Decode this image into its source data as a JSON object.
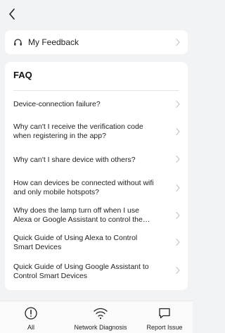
{
  "header": {
    "back_icon": "chevron-left-icon"
  },
  "feedback": {
    "label": "My Feedback",
    "icon": "headset-icon"
  },
  "faq": {
    "title": "FAQ",
    "items": [
      {
        "lines": [
          "Device-connection failure?"
        ]
      },
      {
        "lines": [
          "Why can't I receive the verification code",
          "when registering in the app?"
        ]
      },
      {
        "lines": [
          "Why can't I share device with others?"
        ]
      },
      {
        "lines": [
          "How can devices be connected without wifi",
          "and only mobile hotspots?"
        ]
      },
      {
        "lines": [
          "Why does the lamp turn off when I use",
          "Alexa or Google Assistant to control the…"
        ]
      },
      {
        "lines": [
          "Quick Guide of Using Alexa to Control",
          "Smart Devices"
        ]
      },
      {
        "lines": [
          "Quick Guide of Using Google Assistant to",
          "Control Smart Devices"
        ]
      }
    ]
  },
  "tabs": [
    {
      "label": "All",
      "icon": "alert-circle-icon"
    },
    {
      "label": "Network Diagnosis",
      "icon": "wifi-icon"
    },
    {
      "label": "Report Issue",
      "icon": "message-square-icon"
    }
  ],
  "colors": {
    "background": "#f2f3f5",
    "card": "#ffffff",
    "chevron": "#c4c5c8",
    "text": "#222222"
  }
}
